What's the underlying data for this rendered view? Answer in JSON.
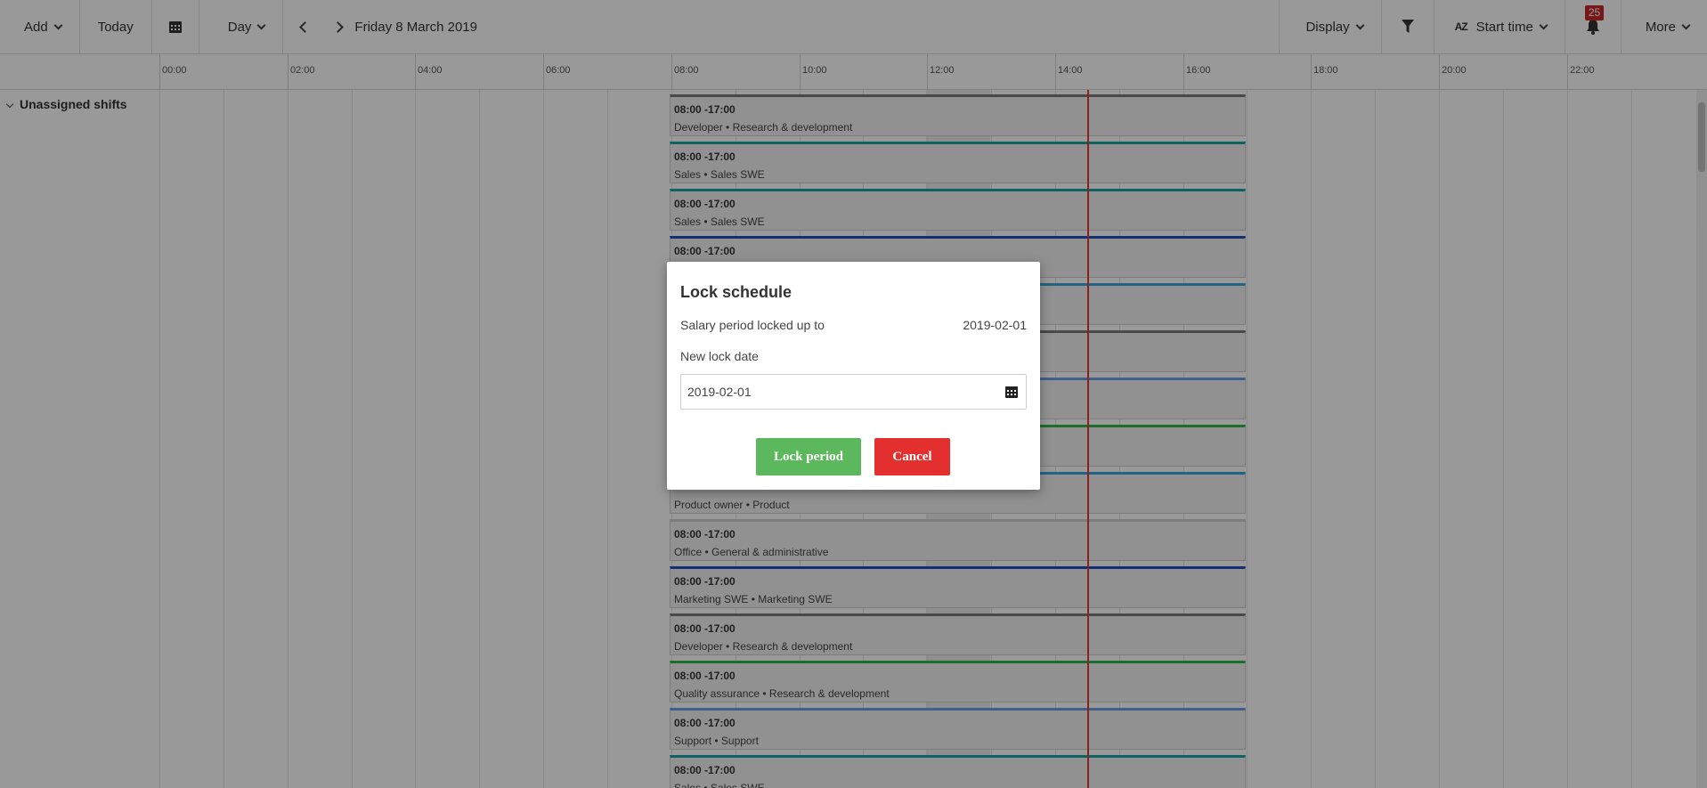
{
  "toolbar": {
    "add": "Add",
    "today": "Today",
    "view": "Day",
    "date": "Friday 8 March 2019",
    "display": "Display",
    "sort": "Start time",
    "sort_icon_text": "AZ",
    "notifications_count": "25",
    "more": "More"
  },
  "timeline": {
    "hours": [
      "00:00",
      "02:00",
      "04:00",
      "06:00",
      "08:00",
      "10:00",
      "12:00",
      "14:00",
      "16:00",
      "18:00",
      "20:00",
      "22:00"
    ],
    "group": "Unassigned shifts"
  },
  "shifts": [
    {
      "time": "08:00 -17:00",
      "role": "Developer • Research & development",
      "color": "#7a7a7a"
    },
    {
      "time": "08:00 -17:00",
      "role": "Sales • Sales SWE",
      "color": "#1aa3a3"
    },
    {
      "time": "08:00 -17:00",
      "role": "Sales • Sales SWE",
      "color": "#1aa3a3"
    },
    {
      "time": "08:00 -17:00",
      "role": "",
      "color": "#1e4fc2"
    },
    {
      "time": "",
      "role": "",
      "color": "#36a7e0"
    },
    {
      "time": "",
      "role": "",
      "color": "#7a7a7a"
    },
    {
      "time": "",
      "role": "",
      "color": "#6d9ee8"
    },
    {
      "time": "",
      "role": "",
      "color": "#2fb84a"
    },
    {
      "time": "",
      "role": "Product owner • Product",
      "color": "#36a7e0"
    },
    {
      "time": "08:00 -17:00",
      "role": "Office • General & administrative",
      "color": "#d0d0d0"
    },
    {
      "time": "08:00 -17:00",
      "role": "Marketing SWE • Marketing SWE",
      "color": "#1e4fc2"
    },
    {
      "time": "08:00 -17:00",
      "role": "Developer • Research & development",
      "color": "#7a7a7a"
    },
    {
      "time": "08:00 -17:00",
      "role": "Quality assurance • Research & development",
      "color": "#2fb84a"
    },
    {
      "time": "08:00 -17:00",
      "role": "Support • Support",
      "color": "#6d9ee8"
    },
    {
      "time": "08:00 -17:00",
      "role": "Sales • Sales SWE",
      "color": "#1aa3a3"
    }
  ],
  "dialog": {
    "title": "Lock schedule",
    "locked_label": "Salary period locked up to",
    "locked_value": "2019-02-01",
    "new_date_label": "New lock date",
    "new_date_value": "2019-02-01",
    "lock_button": "Lock period",
    "cancel_button": "Cancel"
  },
  "colors": {
    "lock": "#5cb85c",
    "cancel": "#e3302f",
    "now_line": "#e53935",
    "badge": "#c62828"
  }
}
